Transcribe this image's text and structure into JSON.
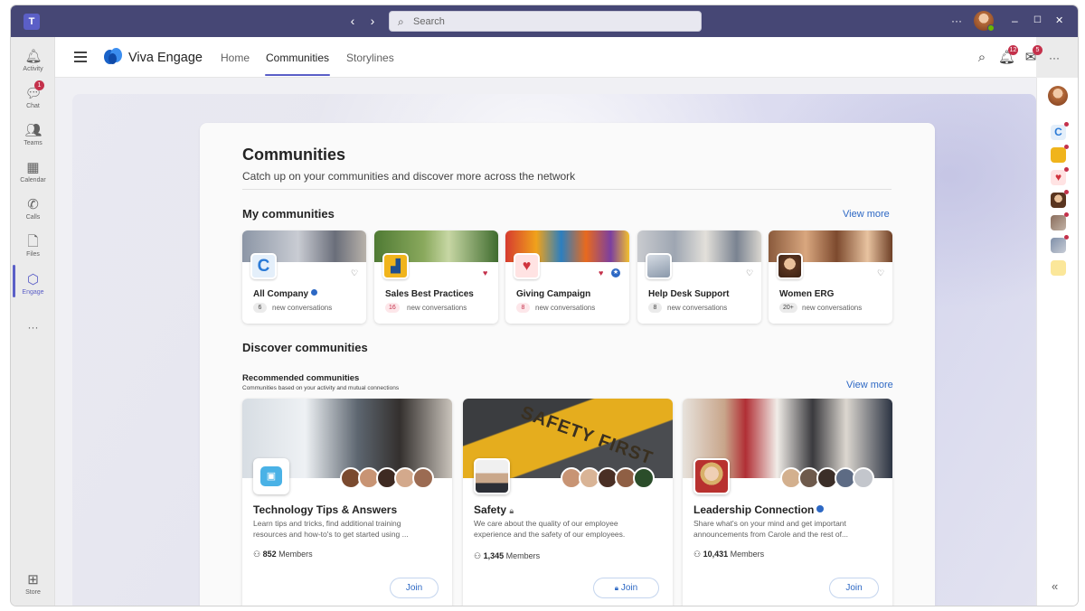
{
  "titlebar": {
    "search_placeholder": "Search",
    "more_label": "···",
    "min_label": "–",
    "max_label": "☐",
    "close_label": "✕"
  },
  "rail": {
    "items": [
      {
        "label": "Activity",
        "icon": "bell-icon"
      },
      {
        "label": "Chat",
        "icon": "chat-icon",
        "badge": "1"
      },
      {
        "label": "Teams",
        "icon": "teams-icon"
      },
      {
        "label": "Calendar",
        "icon": "calendar-icon"
      },
      {
        "label": "Calls",
        "icon": "phone-icon"
      },
      {
        "label": "Files",
        "icon": "file-icon"
      },
      {
        "label": "Engage",
        "icon": "engage-icon",
        "active": true
      }
    ],
    "more_label": "···",
    "store_label": "Store"
  },
  "header": {
    "app_name": "Viva Engage",
    "tabs": [
      {
        "label": "Home"
      },
      {
        "label": "Communities",
        "active": true
      },
      {
        "label": "Storylines"
      }
    ],
    "notif_badge": "12",
    "inbox_badge": "5",
    "more_label": "···"
  },
  "page": {
    "title": "Communities",
    "subtitle": "Catch up on your communities and discover more across the network",
    "my_communities_heading": "My communities",
    "view_more": "View more",
    "discover_heading": "Discover communities",
    "recommended_title": "Recommended communities",
    "recommended_sub": "Communities based on your activity and mutual connections",
    "view_more_2": "View more"
  },
  "my_communities": [
    {
      "name": "All Company",
      "count": "6",
      "label": "new conversations",
      "verified": true,
      "favorited": false
    },
    {
      "name": "Sales Best Practices",
      "count": "16",
      "label": "new conversations",
      "verified": false,
      "favorited": true
    },
    {
      "name": "Giving Campaign",
      "count": "8",
      "label": "new conversations",
      "verified": false,
      "favorited": true
    },
    {
      "name": "Help Desk Support",
      "count": "8",
      "label": "new conversations",
      "verified": false,
      "favorited": false
    },
    {
      "name": "Women ERG",
      "count": "20+",
      "label": "new conversations",
      "verified": false,
      "favorited": false
    }
  ],
  "discover": [
    {
      "name": "Technology Tips & Answers",
      "desc": "Learn tips and tricks, find additional training resources and how-to's to get started using ...",
      "members_count": "852",
      "members_label": "Members",
      "join": "Join"
    },
    {
      "name": "Safety",
      "desc": "We care about the quality of our employee experience and the safety of our employees.",
      "members_count": "1,345",
      "members_label": "Members",
      "join": "Join"
    },
    {
      "name": "Leadership Connection",
      "desc": "Share what's on your mind and get important announcements from Carole and the rest of...",
      "members_count": "10,431",
      "members_label": "Members",
      "join": "Join"
    }
  ],
  "colors": {
    "titlebar": "#464775",
    "accent": "#5b5fc7",
    "link": "#2d68c4",
    "badge": "#c4314b"
  }
}
